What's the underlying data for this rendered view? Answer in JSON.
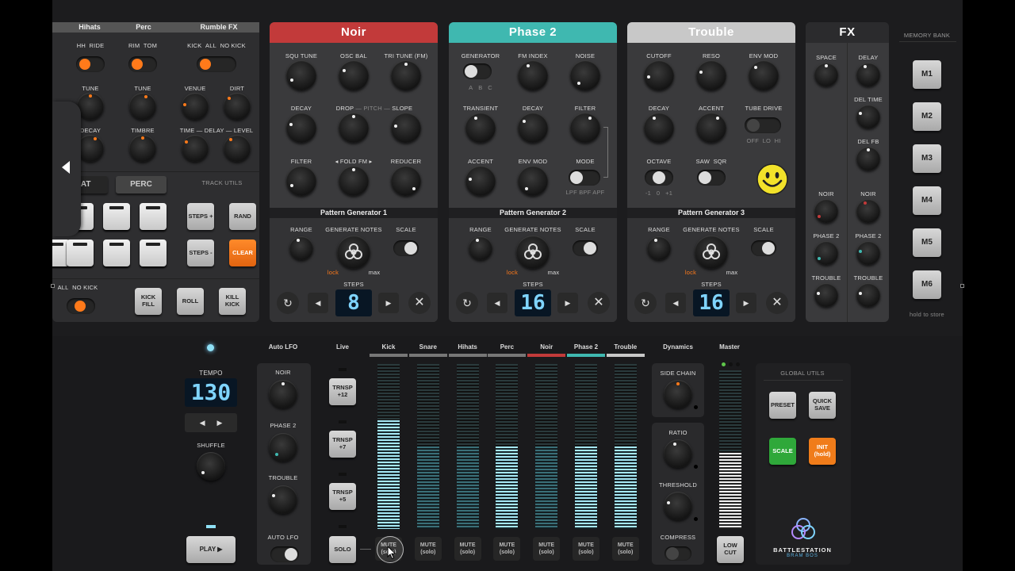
{
  "drums": {
    "tabs": [
      "Hihats",
      "Perc",
      "Rumble FX"
    ],
    "hihat_switch": [
      "HH",
      "RIDE"
    ],
    "perc_switch": [
      "RIM",
      "TOM"
    ],
    "rumble_switch": [
      "KICK",
      "ALL",
      "NO KICK"
    ],
    "knobs": {
      "tune": "TUNE",
      "decay": "DECAY",
      "timbre": "TIMBRE",
      "venue": "VENUE",
      "dirt": "DIRT",
      "time": "TIME",
      "delay": "DELAY",
      "level": "LEVEL"
    },
    "track_tabs": [
      "HHAT",
      "PERC"
    ],
    "track_utils": "TRACK UTILS",
    "steps_plus": "STEPS +",
    "steps_minus": "STEPS -",
    "rand": "RAND",
    "clear": "CLEAR",
    "kick_switch": [
      "ALL",
      "NO KICK"
    ],
    "fill_buttons": [
      "KICK FILL",
      "ROLL",
      "KILL KICK"
    ]
  },
  "synths": [
    {
      "name": "Noir",
      "color": "#c23a3a",
      "labels": [
        "SQU TUNE",
        "OSC BAL",
        "TRI TUNE (FM)",
        "DECAY",
        "DROP",
        "PITCH",
        "SLOPE",
        "FILTER",
        "FOLD",
        "FM",
        "REDUCER"
      ],
      "pattern": "Pattern Generator 1",
      "steps": "8"
    },
    {
      "name": "Phase 2",
      "color": "#3fb8b0",
      "labels": [
        "GENERATOR",
        "FM INDEX",
        "NOISE",
        "TRANSIENT",
        "DECAY",
        "FILTER",
        "ACCENT",
        "ENV MOD",
        "MODE"
      ],
      "gen_options": [
        "A",
        "B",
        "C"
      ],
      "mode_options": [
        "LPF",
        "BPF",
        "APF"
      ],
      "pattern": "Pattern Generator 2",
      "steps": "16"
    },
    {
      "name": "Trouble",
      "color": "#c8c8c8",
      "labels": [
        "CUTOFF",
        "RESO",
        "ENV MOD",
        "DECAY",
        "ACCENT",
        "TUBE DRIVE",
        "OCTAVE",
        "SAW",
        "SQR"
      ],
      "tube_options": [
        "OFF",
        "LO",
        "HI"
      ],
      "octave_options": [
        "-1",
        "0",
        "+1"
      ],
      "pattern": "Pattern Generator 3",
      "steps": "16"
    }
  ],
  "patgen": {
    "range": "RANGE",
    "generate": "GENERATE NOTES",
    "scale": "SCALE",
    "lock": "lock",
    "max": "max",
    "steps": "STEPS"
  },
  "fx": {
    "title": "FX",
    "left": [
      "SPACE",
      "NOIR",
      "PHASE 2",
      "TROUBLE"
    ],
    "right": [
      "DELAY",
      "DEL TIME",
      "DEL FB",
      "NOIR",
      "PHASE 2",
      "TROUBLE"
    ]
  },
  "memory": {
    "title": "MEMORY BANK",
    "slots": [
      "M1",
      "M2",
      "M3",
      "M4",
      "M5",
      "M6"
    ],
    "hint": "hold to store"
  },
  "transport": {
    "tempo_label": "TEMPO",
    "tempo": "130",
    "shuffle": "SHUFFLE",
    "play": "PLAY ▶"
  },
  "autolfo": {
    "title": "Auto LFO",
    "knobs": [
      "NOIR",
      "PHASE 2",
      "TROUBLE"
    ],
    "toggle": "AUTO LFO"
  },
  "live": {
    "title": "Live",
    "buttons": [
      "TRNSP +12",
      "TRNSP +7",
      "TRNSP +5",
      "SOLO"
    ]
  },
  "mixer": {
    "channels": [
      {
        "name": "Kick",
        "color": "#777777",
        "level": 0.66,
        "dim": false
      },
      {
        "name": "Snare",
        "color": "#777777",
        "level": 0.5,
        "dim": true
      },
      {
        "name": "Hihats",
        "color": "#777777",
        "level": 0.5,
        "dim": true
      },
      {
        "name": "Perc",
        "color": "#777777",
        "level": 0.5,
        "dim": false
      },
      {
        "name": "Noir",
        "color": "#c23a3a",
        "level": 0.5,
        "dim": true
      },
      {
        "name": "Phase 2",
        "color": "#3fb8b0",
        "level": 0.5,
        "dim": false
      },
      {
        "name": "Trouble",
        "color": "#c8c8c8",
        "level": 0.5,
        "dim": false
      }
    ],
    "mute_label": "MUTE",
    "solo_label": "(solo)"
  },
  "dynamics": {
    "title": "Dynamics",
    "sidechain": "SIDE CHAIN",
    "ratio": "RATIO",
    "threshold": "THRESHOLD",
    "compress": "COMPRESS"
  },
  "master": {
    "title": "Master",
    "level": 0.48,
    "lowcut": "LOW CUT"
  },
  "global": {
    "title": "GLOBAL UTILS",
    "preset": "PRESET",
    "quicksave": "QUICK SAVE",
    "scale": "SCALE",
    "init": "INIT (hold)",
    "scale_color": "#2fa83a",
    "init_color": "#f07c1a"
  },
  "brand": {
    "name": "BATTLESTATION",
    "sub": "BRAM BOS"
  }
}
